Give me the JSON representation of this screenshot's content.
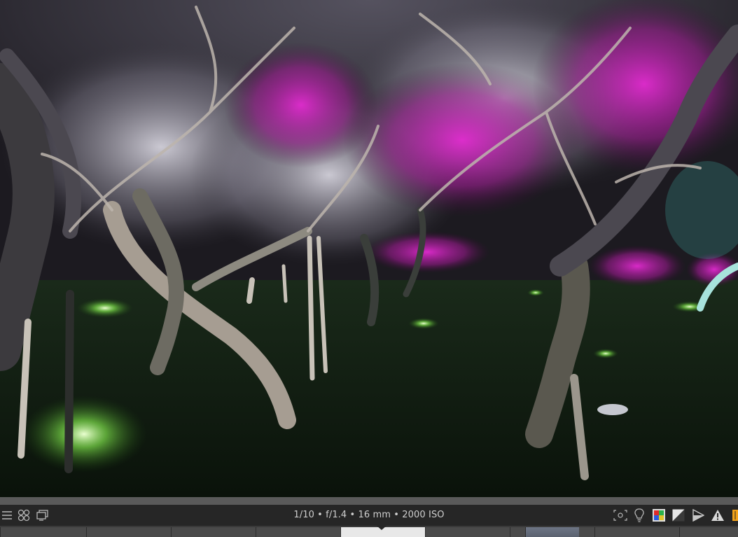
{
  "viewer": {
    "image_subject": "illuminated plum blossom grove at night"
  },
  "toolbar": {
    "left_icons": [
      "menu-icon",
      "color-picker-icon",
      "display-icon"
    ],
    "exif": {
      "shutter": "1/10",
      "aperture": "f/1.4",
      "focal_length": "16 mm",
      "iso": "2000 ISO",
      "separator": " • "
    },
    "right_icons": [
      "focus-peaking-icon",
      "lightbulb-icon",
      "color-assessment-icon",
      "clipping-icon",
      "softproof-icon",
      "gamut-warning-icon"
    ]
  },
  "colors": {
    "toolbar_bg": "#262626",
    "divider": "#5a5a5a",
    "filmstrip_bg": "#3a3a3a",
    "selected_thumb": "#e8e8e8"
  }
}
